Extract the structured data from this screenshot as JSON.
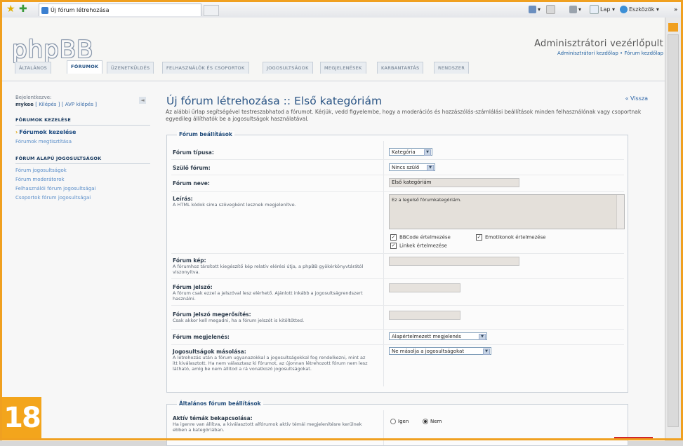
{
  "browser": {
    "tab_title": "Új fórum létrehozása",
    "toolbar": {
      "page_label": "Lap",
      "tools_label": "Eszközök"
    }
  },
  "header": {
    "logo": "phpBB",
    "title": "Adminisztrátori vezérlőpult",
    "links": {
      "acp_index": "Adminisztrátori kezdőlap",
      "separator": "•",
      "forum_index": "Fórum kezdőlap"
    }
  },
  "tabs": [
    {
      "label": "ÁLTALÁNOS",
      "active": false
    },
    {
      "label": "FÓRUMOK",
      "active": true
    },
    {
      "label": "ÜZENETKÜLDÉS",
      "active": false
    },
    {
      "label": "FELHASZNÁLÓK ÉS CSOPORTOK",
      "active": false
    },
    {
      "label": "JOGOSULTSÁGOK",
      "active": false
    },
    {
      "label": "MEGJELENÉSEK",
      "active": false
    },
    {
      "label": "KARBANTARTÁS",
      "active": false
    },
    {
      "label": "RENDSZER",
      "active": false
    }
  ],
  "sidebar": {
    "logged_in_label": "Bejelentkezve:",
    "username": "mykee",
    "logout_link": "[ Kilépés ]",
    "acp_logout_link": "[ AVP kilépés ]",
    "collapse": "◄",
    "sections": [
      {
        "title": "FÓRUMOK KEZELÉSE",
        "items": [
          "Fórumok kezelése",
          "Fórumok megtisztítása"
        ]
      },
      {
        "title": "FÓRUM ALAPÚ JOGOSULTSÁGOK",
        "items": [
          "Fórum jogosultságok",
          "Fórum moderátorok",
          "Felhasználói fórum jogosultságai",
          "Csoportok fórum jogosultságai"
        ]
      }
    ]
  },
  "main": {
    "title": "Új fórum létrehozása :: Első kategóriám",
    "back": "« Vissza",
    "intro": "Az alábbi űrlap segítségével testreszabhatod a fórumot. Kérjük, vedd figyelembe, hogy a moderációs és hozzászólás-számlálási beállítások minden felhasználónak vagy csoportnak egyedileg állíthatók be a jogosultságok használatával.",
    "settings_legend": "Fórum beállítások",
    "fields": {
      "type_label": "Fórum típusa:",
      "type_value": "Kategória",
      "parent_label": "Szülő fórum:",
      "parent_value": "Nincs szülő",
      "name_label": "Fórum neve:",
      "name_value": "Első kategóriám",
      "desc_label": "Leírás:",
      "desc_help": "A HTML kódok sima szövegként lesznek megjelenítve.",
      "desc_value": "Ez a legelső fórumkategóriám.",
      "bbcode": "BBCode értelmezése",
      "smilies": "Emotikonok értelmezése",
      "links": "Linkek értelmezése",
      "image_label": "Fórum kép:",
      "image_help": "A fórumhoz társított kiegészítő kép relatív elérési útja, a phpBB gyökérkönyvtárától viszonyítva.",
      "password_label": "Fórum jelszó:",
      "password_help": "A fórum csak ezzel a jelszóval lesz elérhető. Ajánlott inkább a jogosultságrendszert használni.",
      "password_confirm_label": "Fórum jelszó megerősítés:",
      "password_confirm_help": "Csak akkor kell megadni, ha a fórum jelszót is kitöltötted.",
      "style_label": "Fórum megjelenés:",
      "style_value": "Alapértelmezett megjelenés",
      "copy_perm_label": "Jogosultságok másolása:",
      "copy_perm_help": "A létrehozás után a fórum ugyanazokkal a jogosultságokkal fog rendelkezni, mint az itt kiválasztott. Ha nem választasz ki fórumot, az újonnan létrehozott fórum nem lesz látható, amíg be nem állítod a rá vonatkozó jogosultságokat.",
      "copy_perm_value": "Ne másolja a jogosultságokat"
    },
    "general_legend": "Általános fórum beállítások",
    "active_topics_label": "Aktív témák bekapcsolása:",
    "active_topics_help": "Ha igenre van állítva, a kiválasztott alfórumok aktív témái megjelenítésre kerülnek ebben a kategóriában.",
    "yes": "Igen",
    "no": "Nem",
    "active_topics_selected": "Nem"
  },
  "page_number": "18",
  "colors": {
    "accent": "#f3a51c",
    "link": "#2f66a8",
    "heading": "#2b5585"
  }
}
